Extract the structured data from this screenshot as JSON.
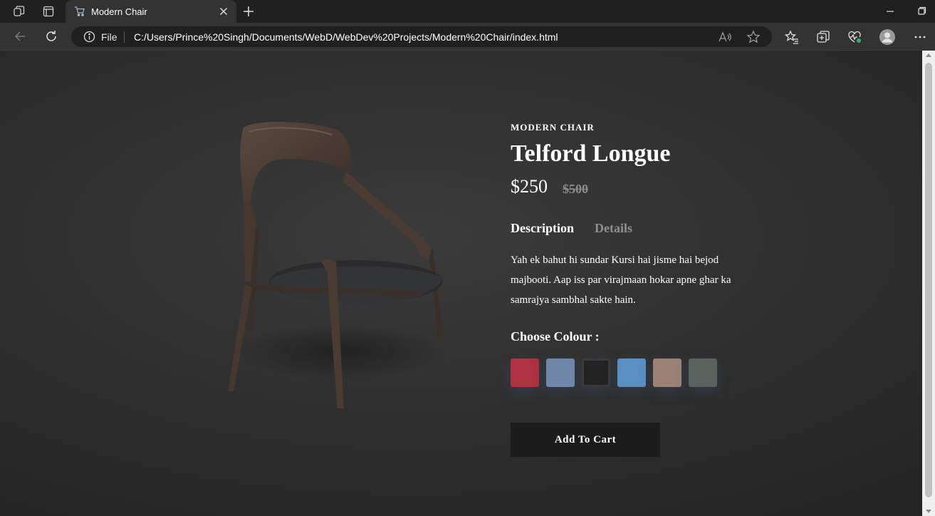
{
  "browser": {
    "tab_title": "Modern Chair",
    "address": {
      "scheme_label": "File",
      "url": "C:/Users/Prince%20Singh/Documents/WebD/WebDev%20Projects/Modern%20Chair/index.html"
    },
    "icons": {
      "workspaces": "workspaces-icon",
      "tab_actions": "tab-actions-icon",
      "close": "close-icon",
      "new_tab": "plus-icon",
      "back": "back-arrow-icon",
      "refresh": "refresh-icon",
      "info": "info-icon",
      "read_aloud": "read-aloud-icon",
      "favorite": "star-icon",
      "favorites": "favorites-icon",
      "collections": "collections-icon",
      "health": "browser-essentials-icon",
      "profile": "profile-icon",
      "more": "more-icon"
    }
  },
  "product": {
    "eyebrow": "MODERN CHAIR",
    "name": "Telford Longue",
    "price": "$250",
    "old_price": "$500",
    "tabs": [
      {
        "label": "Description",
        "active": true
      },
      {
        "label": "Details",
        "active": false
      }
    ],
    "description": "Yah ek bahut hi sundar Kursi hai jisme hai bejod majbooti. Aap iss par virajmaan hokar apne ghar ka samrajya sambhal sakte hain.",
    "colour_label": "Choose Colour :",
    "colours": [
      {
        "name": "red",
        "hex": "#b0313f"
      },
      {
        "name": "denim",
        "hex": "#6f88aa"
      },
      {
        "name": "black",
        "hex": "#232323",
        "selected": true
      },
      {
        "name": "blue",
        "hex": "#5a8fc2"
      },
      {
        "name": "taupe",
        "hex": "#9a8275"
      },
      {
        "name": "grey-green",
        "hex": "#5a625e"
      }
    ],
    "cart_label": "Add To Cart"
  }
}
